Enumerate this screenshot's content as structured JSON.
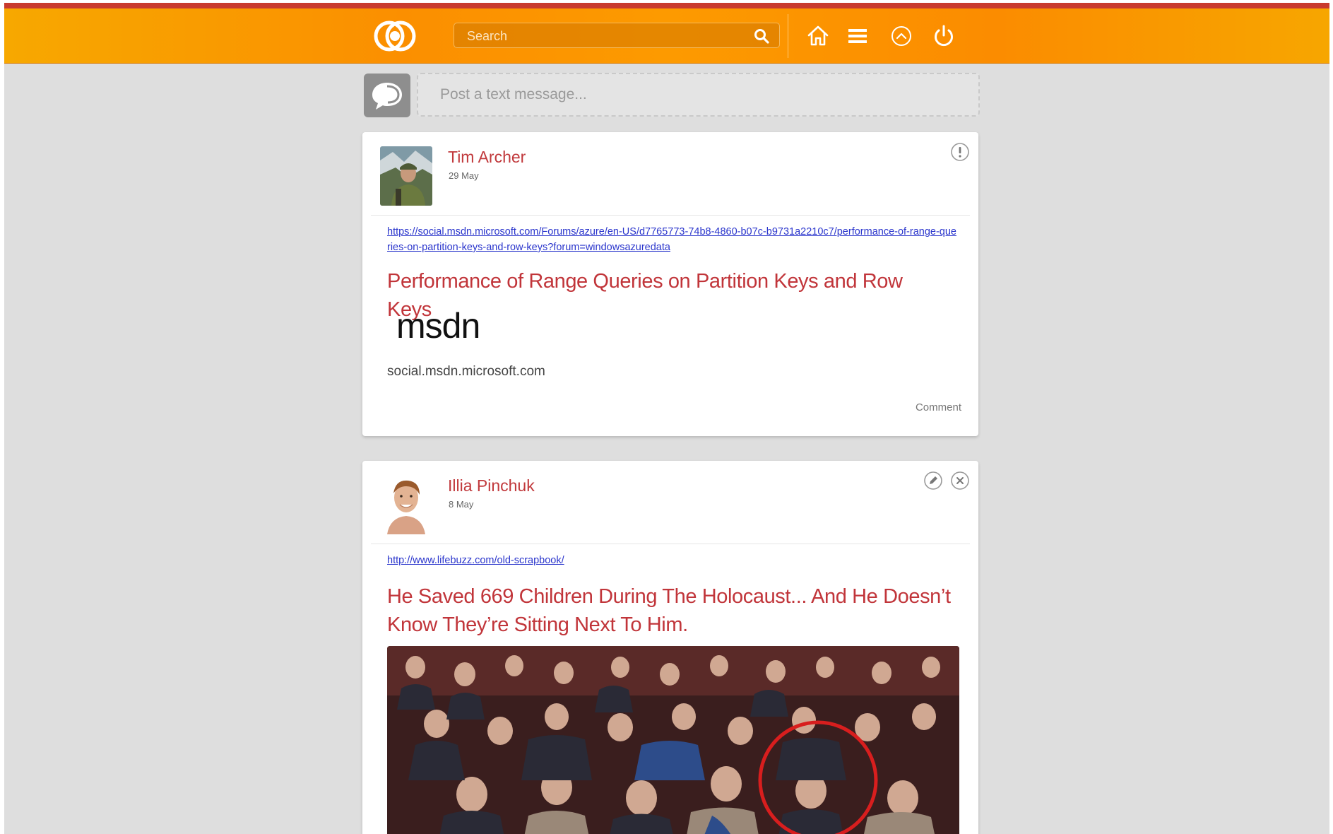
{
  "header": {
    "search_placeholder": "Search",
    "nav": [
      {
        "name": "home-icon"
      },
      {
        "name": "menu-icon"
      },
      {
        "name": "chevron-up-icon"
      },
      {
        "name": "power-icon"
      }
    ],
    "colors": {
      "bar_start": "#f7a800",
      "bar_mid": "#fb8f00",
      "accent_line": "#c83a2e"
    }
  },
  "composer": {
    "placeholder": "Post a text message..."
  },
  "posts": [
    {
      "author": "Tim Archer",
      "date": "29 May",
      "url": "https://social.msdn.microsoft.com/Forums/azure/en-US/d7765773-74b8-4860-b07c-b9731a2210c7/performance-of-range-queries-on-partition-keys-and-row-keys?forum=windowsazuredata",
      "title": "Performance of Range Queries on Partition Keys and Row Keys",
      "site_logo_text": "msdn",
      "domain": "social.msdn.microsoft.com",
      "comment_label": "Comment",
      "actions": [
        "report-icon"
      ]
    },
    {
      "author": "Illia Pinchuk",
      "date": "8 May",
      "url": "http://www.lifebuzz.com/old-scrapbook/",
      "title": "He Saved 669 Children During The Holocaust... And He Doesn’t Know They’re Sitting Next To Him.",
      "actions": [
        "edit-icon",
        "delete-icon"
      ]
    }
  ],
  "theme": {
    "accent_text": "#c1393c",
    "link_color": "#2a35cc",
    "page_bg": "#dedede"
  }
}
